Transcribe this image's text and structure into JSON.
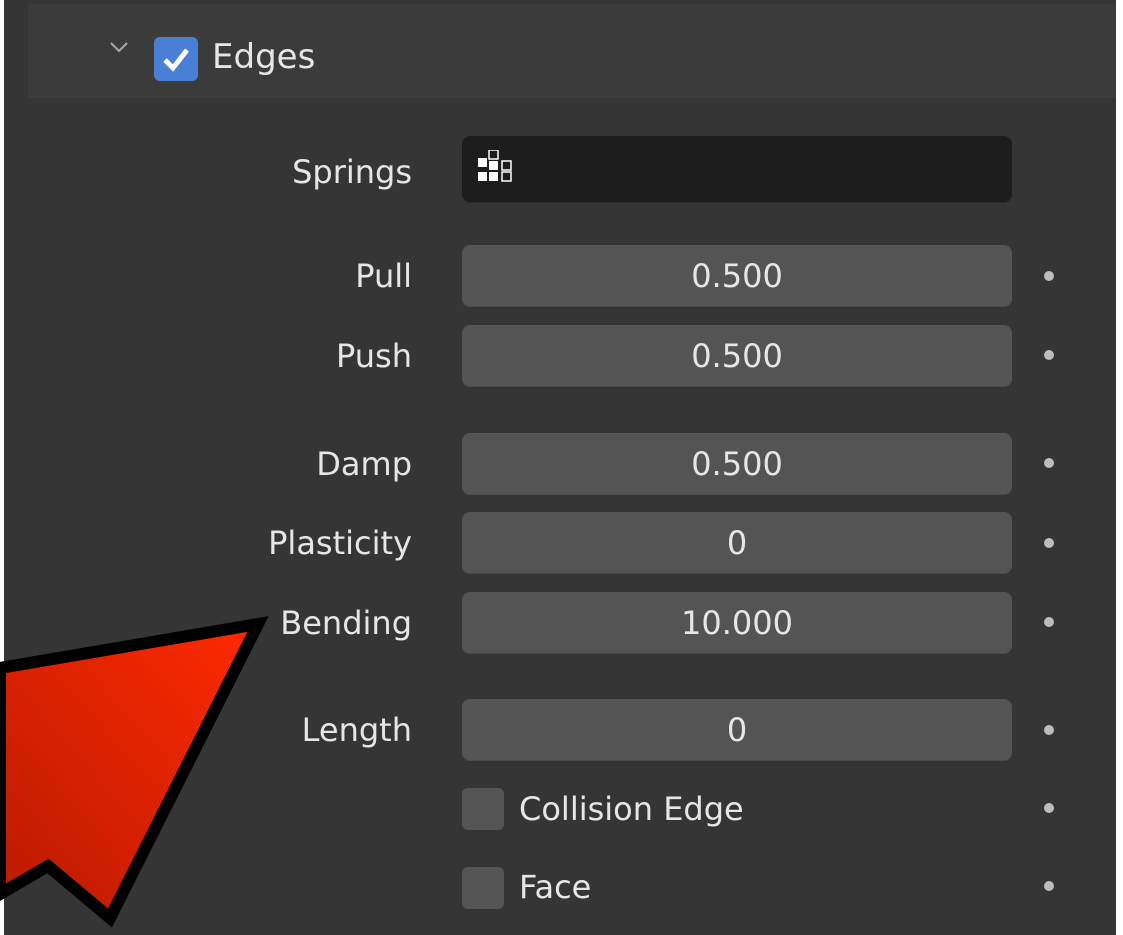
{
  "colors": {
    "panel_bg": "#353535",
    "header_bg": "#3b3b3b",
    "field_bg": "#545454",
    "field_dark_bg": "#1d1d1d",
    "accent": "#4a7fd6",
    "arrow": "#e52a00",
    "text": "#e6e6e6"
  },
  "header": {
    "title": "Edges",
    "checked": true,
    "expand_icon": "chevron-down-icon"
  },
  "springs": {
    "label": "Springs",
    "icon": "vertex-group-icon",
    "value": ""
  },
  "fields": [
    {
      "label": "Pull",
      "value": "0.500"
    },
    {
      "label": "Push",
      "value": "0.500"
    },
    {
      "label": "Damp",
      "value": "0.500"
    },
    {
      "label": "Plasticity",
      "value": "0"
    },
    {
      "label": "Bending",
      "value": "10.000"
    },
    {
      "label": "Length",
      "value": "0"
    }
  ],
  "checkboxes": [
    {
      "label": "Collision Edge",
      "checked": false
    },
    {
      "label": "Face",
      "checked": false
    }
  ],
  "annotation": {
    "shape": "red-arrow",
    "points_to": "Bending"
  }
}
